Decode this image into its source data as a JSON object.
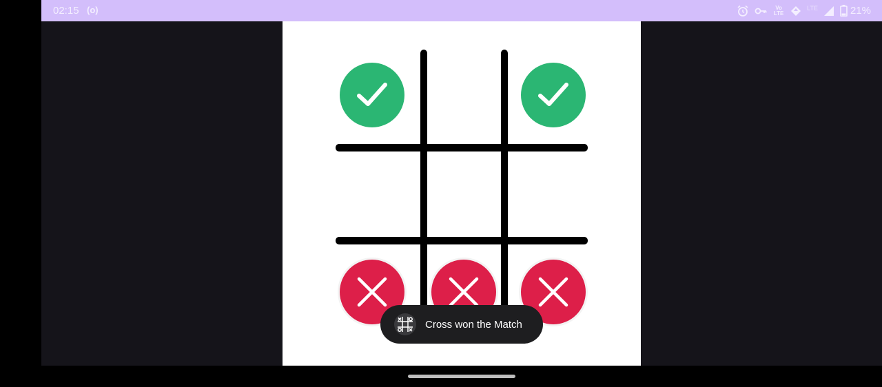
{
  "status_bar": {
    "time": "02:15",
    "radio_indicator": "(o)",
    "icons": [
      "alarm-icon",
      "key-icon",
      "volte-icon",
      "data-arrows-icon",
      "lte-icon",
      "signal-icon",
      "battery-icon"
    ],
    "volte_label": "Vo LTE",
    "lte_label": "LTE",
    "battery": "21%"
  },
  "game": {
    "board": [
      [
        "check",
        "",
        "check"
      ],
      [
        "",
        "",
        ""
      ],
      [
        "cross",
        "cross",
        "cross"
      ]
    ]
  },
  "toast": {
    "message": "Cross won the Match",
    "icon": "tic-tac-toe-icon"
  },
  "colors": {
    "status_bar": "#d3befb",
    "app_background": "#15141a",
    "board_background": "#ffffff",
    "check": "#2bb673",
    "cross": "#dd1f49",
    "toast": "#1e1e20"
  }
}
